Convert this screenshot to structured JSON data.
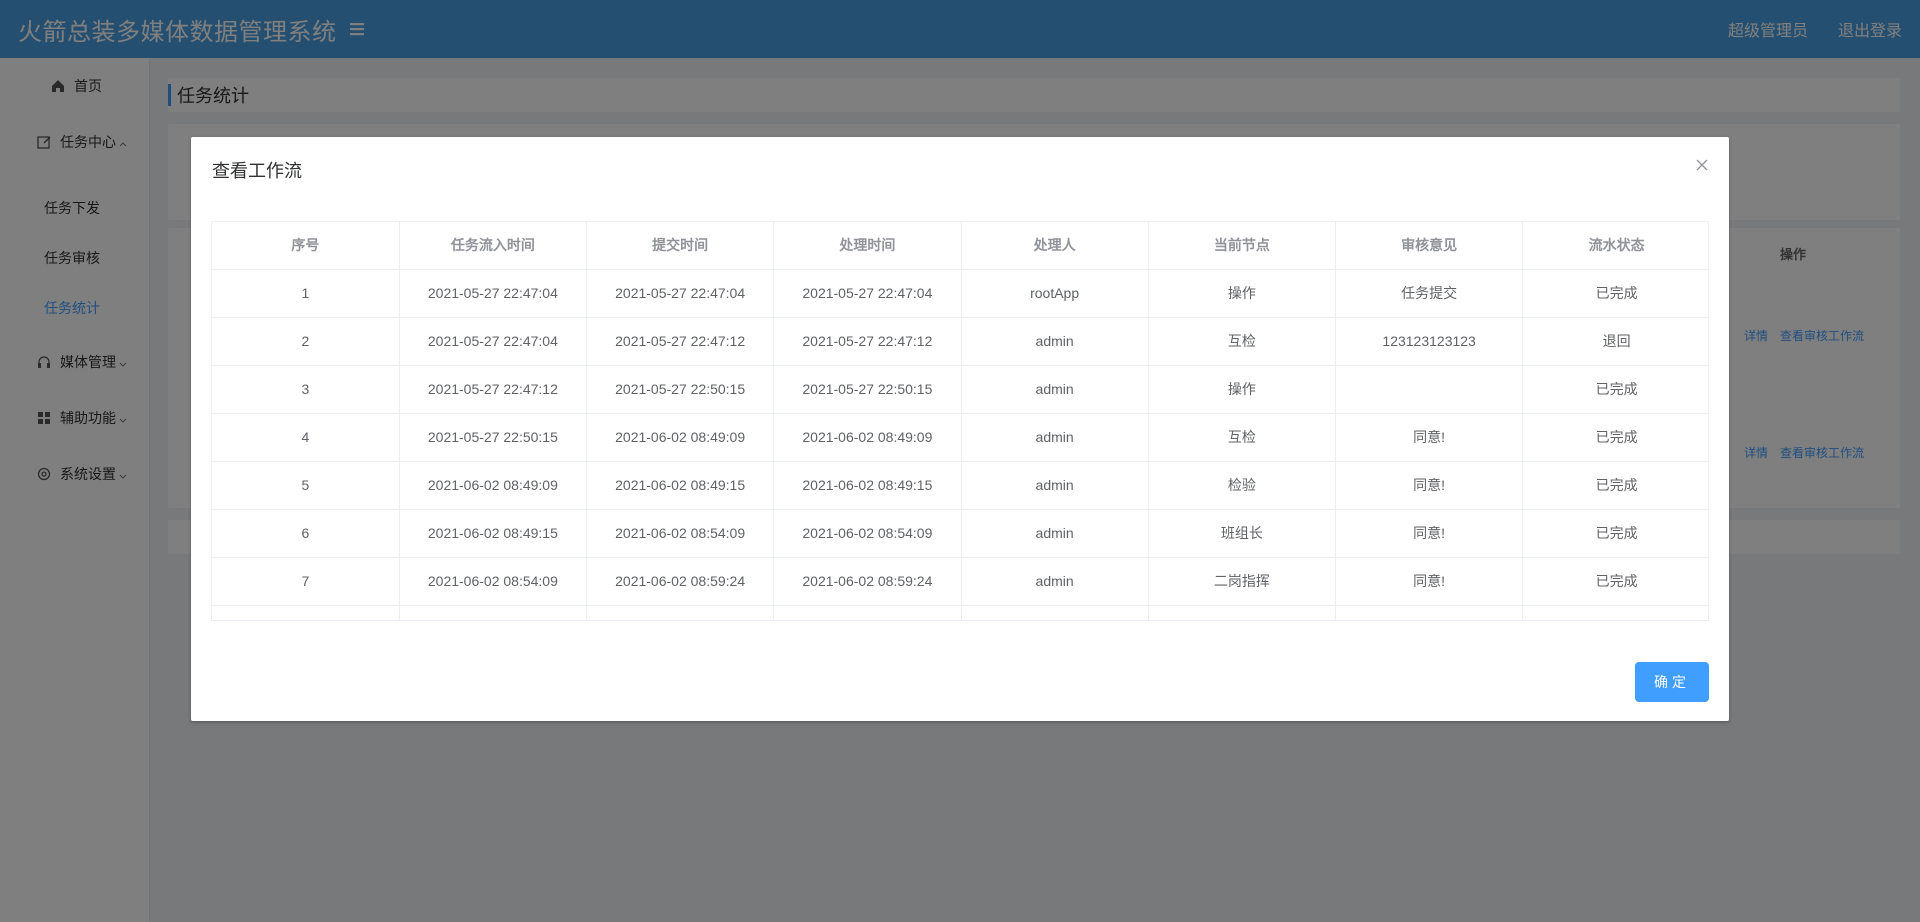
{
  "header": {
    "title": "火箭总装多媒体数据管理系统",
    "user": "超级管理员",
    "logout": "退出登录"
  },
  "sidebar": {
    "home": "首页",
    "task_center": "任务中心",
    "task_issue": "任务下发",
    "task_review": "任务审核",
    "task_stats": "任务统计",
    "media_mgmt": "媒体管理",
    "aux_funcs": "辅助功能",
    "sys_settings": "系统设置"
  },
  "page": {
    "title": "任务统计",
    "op_header": "操作",
    "detail_link": "详情",
    "workflow_link": "查看审核工作流"
  },
  "dialog": {
    "title": "查看工作流",
    "confirm": "确定",
    "columns": [
      "序号",
      "任务流入时间",
      "提交时间",
      "处理时间",
      "处理人",
      "当前节点",
      "审核意见",
      "流水状态"
    ],
    "rows": [
      [
        "1",
        "2021-05-27 22:47:04",
        "2021-05-27 22:47:04",
        "2021-05-27 22:47:04",
        "rootApp",
        "操作",
        "任务提交",
        "已完成"
      ],
      [
        "2",
        "2021-05-27 22:47:04",
        "2021-05-27 22:47:12",
        "2021-05-27 22:47:12",
        "admin",
        "互检",
        "123123123123",
        "退回"
      ],
      [
        "3",
        "2021-05-27 22:47:12",
        "2021-05-27 22:50:15",
        "2021-05-27 22:50:15",
        "admin",
        "操作",
        "",
        "已完成"
      ],
      [
        "4",
        "2021-05-27 22:50:15",
        "2021-06-02 08:49:09",
        "2021-06-02 08:49:09",
        "admin",
        "互检",
        "同意!",
        "已完成"
      ],
      [
        "5",
        "2021-06-02 08:49:09",
        "2021-06-02 08:49:15",
        "2021-06-02 08:49:15",
        "admin",
        "检验",
        "同意!",
        "已完成"
      ],
      [
        "6",
        "2021-06-02 08:49:15",
        "2021-06-02 08:54:09",
        "2021-06-02 08:54:09",
        "admin",
        "班组长",
        "同意!",
        "已完成"
      ],
      [
        "7",
        "2021-06-02 08:54:09",
        "2021-06-02 08:59:24",
        "2021-06-02 08:59:24",
        "admin",
        "二岗指挥",
        "同意!",
        "已完成"
      ]
    ]
  }
}
